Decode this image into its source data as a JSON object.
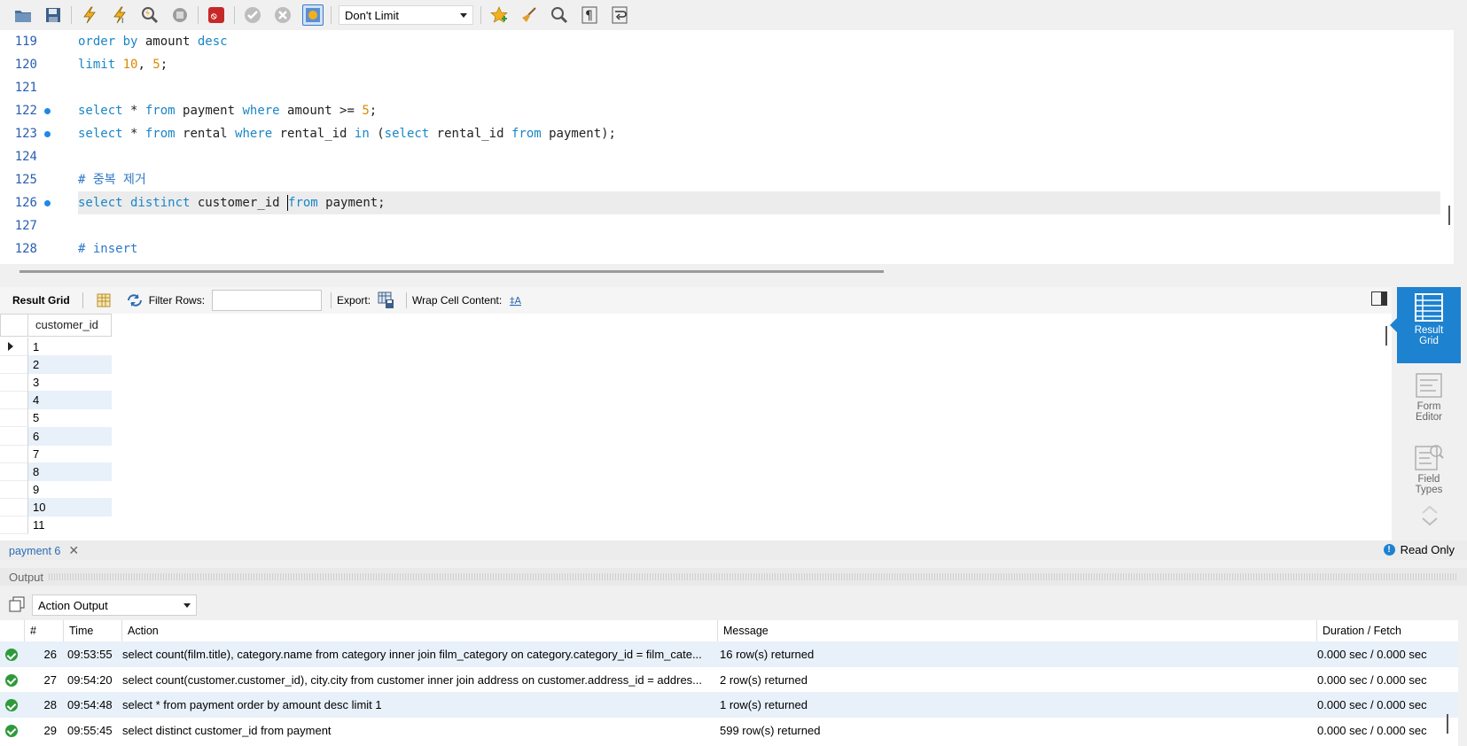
{
  "toolbar": {
    "limit_value": "Don't Limit"
  },
  "editor": {
    "lines": [
      {
        "no": "119",
        "marker": false,
        "tokens": [
          [
            "kw",
            "order by "
          ],
          [
            "",
            "amount "
          ],
          [
            "kw",
            "desc"
          ]
        ]
      },
      {
        "no": "120",
        "marker": false,
        "tokens": [
          [
            "kw",
            "limit "
          ],
          [
            "num",
            "10"
          ],
          [
            "",
            ", "
          ],
          [
            "num",
            "5"
          ],
          [
            "",
            ";"
          ]
        ]
      },
      {
        "no": "121",
        "marker": false,
        "tokens": []
      },
      {
        "no": "122",
        "marker": true,
        "tokens": [
          [
            "kw",
            "select "
          ],
          [
            "",
            "* "
          ],
          [
            "kw",
            "from "
          ],
          [
            "",
            "payment "
          ],
          [
            "kw",
            "where "
          ],
          [
            "",
            "amount >= "
          ],
          [
            "num",
            "5"
          ],
          [
            "",
            ";"
          ]
        ]
      },
      {
        "no": "123",
        "marker": true,
        "tokens": [
          [
            "kw",
            "select "
          ],
          [
            "",
            "* "
          ],
          [
            "kw",
            "from "
          ],
          [
            "",
            "rental "
          ],
          [
            "kw",
            "where "
          ],
          [
            "",
            "rental_id "
          ],
          [
            "kw",
            "in "
          ],
          [
            "",
            "("
          ],
          [
            "kw",
            "select "
          ],
          [
            "",
            "rental_id "
          ],
          [
            "kw",
            "from "
          ],
          [
            "",
            "payment);"
          ]
        ]
      },
      {
        "no": "124",
        "marker": false,
        "tokens": []
      },
      {
        "no": "125",
        "marker": false,
        "tokens": [
          [
            "cmt",
            "# 중복 제거"
          ]
        ]
      },
      {
        "no": "126",
        "marker": true,
        "current": true,
        "tokens": [
          [
            "kw",
            "select distinct "
          ],
          [
            "",
            "customer_id "
          ],
          [
            "cursor",
            ""
          ],
          [
            "kw",
            "from "
          ],
          [
            "",
            "payment;"
          ]
        ]
      },
      {
        "no": "127",
        "marker": false,
        "tokens": []
      },
      {
        "no": "128",
        "marker": false,
        "tokens": [
          [
            "cmt",
            "# insert"
          ]
        ]
      }
    ]
  },
  "result_toolbar": {
    "result_grid_label": "Result Grid",
    "filter_label": "Filter Rows:",
    "filter_value": "",
    "export_label": "Export:",
    "wrap_label": "Wrap Cell Content:"
  },
  "grid": {
    "columns": [
      "customer_id"
    ],
    "rows": [
      "1",
      "2",
      "3",
      "4",
      "5",
      "6",
      "7",
      "8",
      "9",
      "10",
      "11"
    ]
  },
  "side_panel": {
    "result_grid": "Result Grid",
    "form_editor": "Form Editor",
    "field_types": "Field Types"
  },
  "result_tab": {
    "label": "payment 6",
    "status": "Read Only"
  },
  "output": {
    "title": "Output",
    "mode": "Action Output",
    "columns": [
      "#",
      "Time",
      "Action",
      "Message",
      "Duration / Fetch"
    ],
    "rows": [
      {
        "num": "26",
        "time": "09:53:55",
        "action": "select count(film.title), category.name from category inner join film_category on category.category_id = film_cate...",
        "message": "16 row(s) returned",
        "duration": "0.000 sec / 0.000 sec"
      },
      {
        "num": "27",
        "time": "09:54:20",
        "action": "select count(customer.customer_id), city.city from customer inner join address on customer.address_id = addres...",
        "message": "2 row(s) returned",
        "duration": "0.000 sec / 0.000 sec"
      },
      {
        "num": "28",
        "time": "09:54:48",
        "action": "select * from payment order by amount desc limit 1",
        "message": "1 row(s) returned",
        "duration": "0.000 sec / 0.000 sec"
      },
      {
        "num": "29",
        "time": "09:55:45",
        "action": "select distinct customer_id from payment",
        "message": "599 row(s) returned",
        "duration": "0.000 sec / 0.000 sec"
      }
    ]
  },
  "colors": {
    "keyword": "#1a86c7",
    "number": "#d98a00",
    "accent": "#1d82d0",
    "success": "#2e9a3b"
  }
}
